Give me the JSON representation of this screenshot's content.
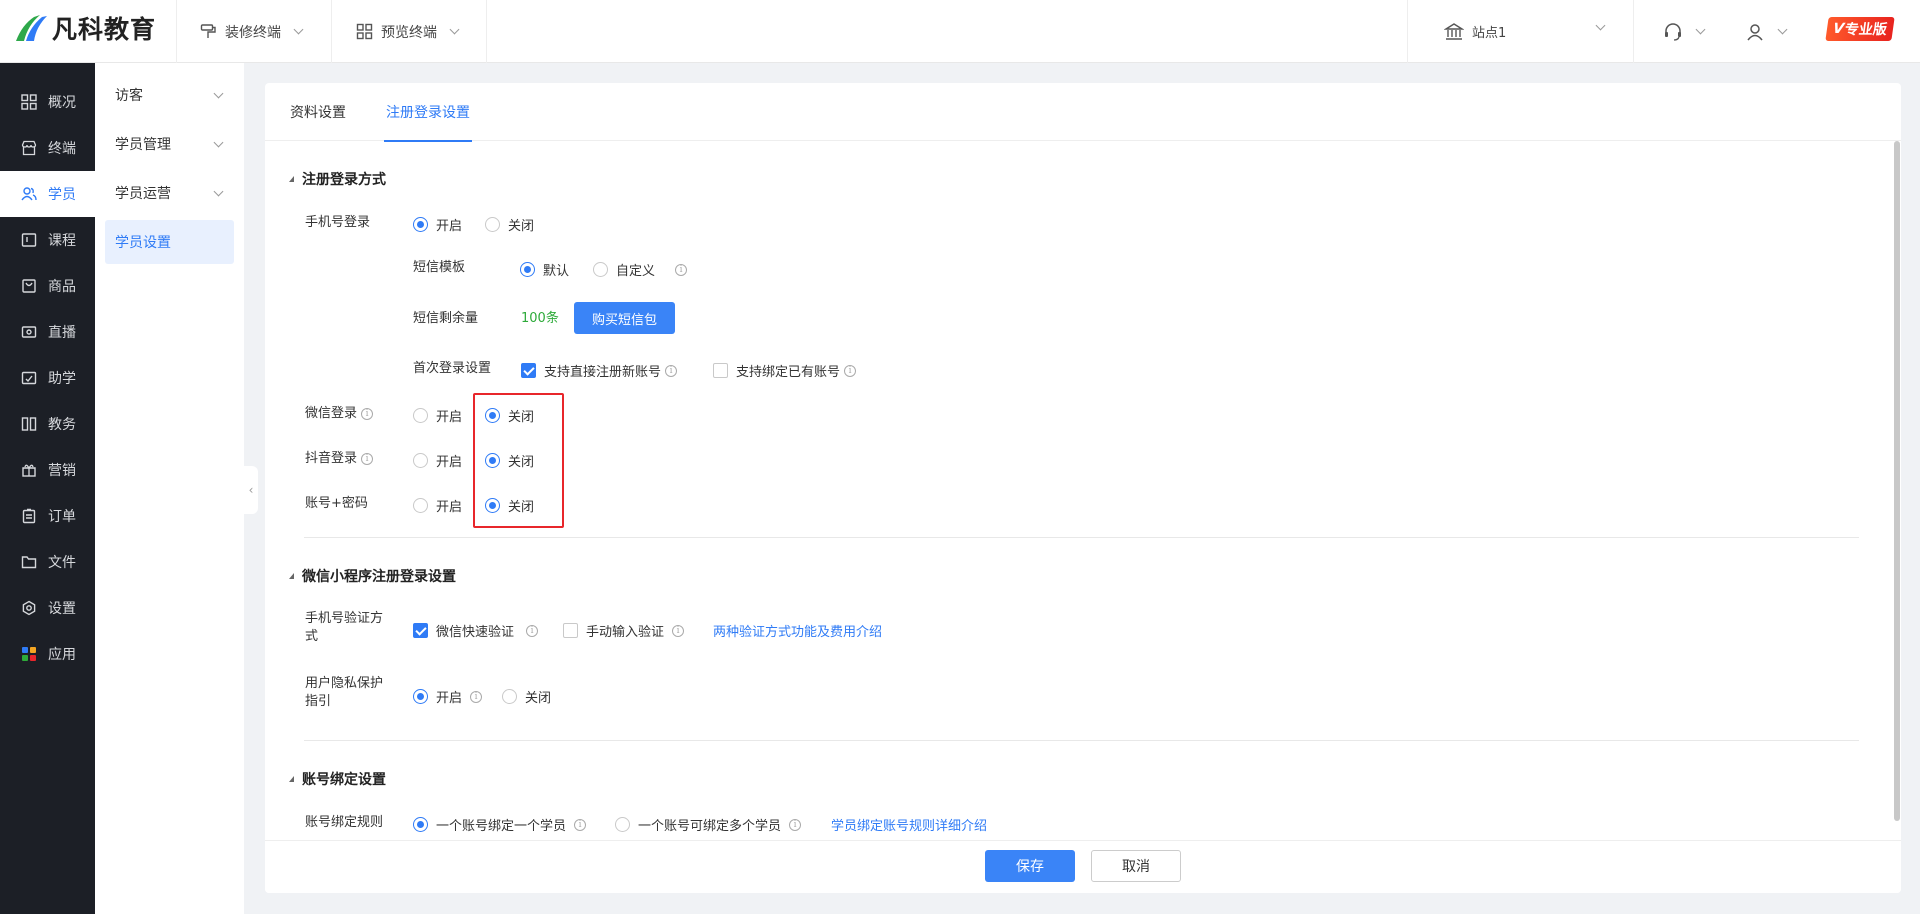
{
  "header": {
    "logo_text": "凡科教育",
    "decorate_terminal": "装修终端",
    "preview_terminal": "预览终端",
    "site_name": "站点1",
    "edition_badge": "专业版",
    "edition_badge_prefix": "V"
  },
  "nav": {
    "items": [
      {
        "label": "概况",
        "icon": "grid-icon"
      },
      {
        "label": "终端",
        "icon": "store-icon"
      },
      {
        "label": "学员",
        "icon": "users-icon"
      },
      {
        "label": "课程",
        "icon": "course-icon"
      },
      {
        "label": "商品",
        "icon": "bag-icon"
      },
      {
        "label": "直播",
        "icon": "live-icon"
      },
      {
        "label": "助学",
        "icon": "assist-icon"
      },
      {
        "label": "教务",
        "icon": "books-icon"
      },
      {
        "label": "营销",
        "icon": "gift-icon"
      },
      {
        "label": "订单",
        "icon": "clipboard-icon"
      },
      {
        "label": "文件",
        "icon": "folder-icon"
      },
      {
        "label": "设置",
        "icon": "gear-icon"
      },
      {
        "label": "应用",
        "icon": "apps-icon"
      }
    ],
    "active_index": 2
  },
  "subnav": {
    "items": [
      "访客",
      "学员管理",
      "学员运营",
      "学员设置"
    ]
  },
  "tabs": [
    "资料设置",
    "注册登录设置"
  ],
  "sections": {
    "login_methods": {
      "title": "注册登录方式",
      "phone_login": "手机号登录",
      "on": "开启",
      "off": "关闭",
      "sms_template": "短信模板",
      "sms_default": "默认",
      "sms_custom": "自定义",
      "sms_remaining": "短信剩余量",
      "sms_count": "100条",
      "buy_sms": "购买短信包",
      "first_login": "首次登录设置",
      "allow_register": "支持直接注册新账号",
      "allow_bind": "支持绑定已有账号",
      "wechat_login": "微信登录",
      "douyin_login": "抖音登录",
      "account_password": "账号+密码"
    },
    "miniprogram": {
      "title": "微信小程序注册登录设置",
      "phone_verify_line1": "手机号验证方",
      "phone_verify_line2": "式",
      "wechat_quick": "微信快速验证",
      "manual_input": "手动输入验证",
      "intro_link": "两种验证方式功能及费用介绍",
      "privacy_line1": "用户隐私保护",
      "privacy_line2": "指引",
      "on": "开启",
      "off": "关闭"
    },
    "binding": {
      "title": "账号绑定设置",
      "rule": "账号绑定规则",
      "one_to_one": "一个账号绑定一个学员",
      "one_to_many": "一个账号可绑定多个学员",
      "rule_link": "学员绑定账号规则详细介绍"
    }
  },
  "footer": {
    "save": "保存",
    "cancel": "取消"
  },
  "colors": {
    "accent": "#2f7bf6",
    "nav_bg": "#1c1f26",
    "highlight": "#e8262b",
    "sms_count": "#2eaa3a"
  }
}
